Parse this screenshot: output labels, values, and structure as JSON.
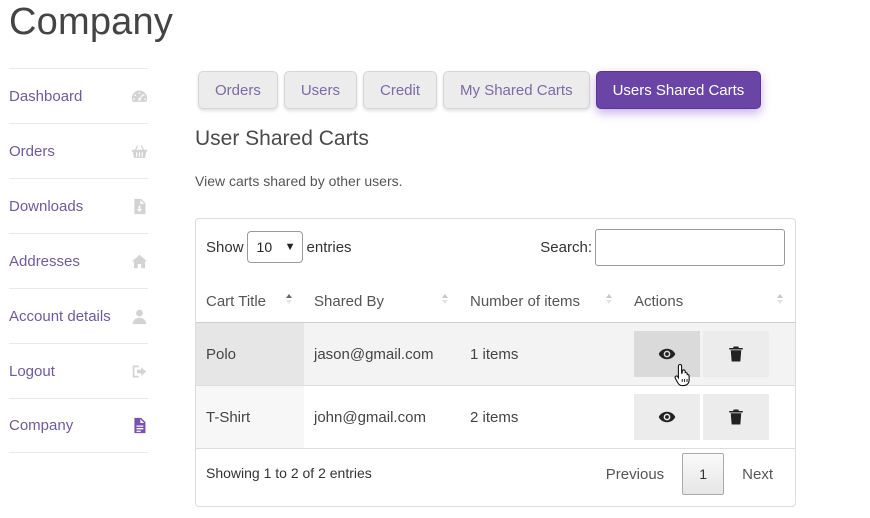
{
  "page": {
    "title": "Company"
  },
  "sidebar": {
    "items": [
      {
        "label": "Dashboard",
        "icon": "dashboard-icon"
      },
      {
        "label": "Orders",
        "icon": "basket-icon"
      },
      {
        "label": "Downloads",
        "icon": "file-download-icon"
      },
      {
        "label": "Addresses",
        "icon": "home-icon"
      },
      {
        "label": "Account details",
        "icon": "user-icon"
      },
      {
        "label": "Logout",
        "icon": "sign-out-icon"
      },
      {
        "label": "Company",
        "icon": "document-icon",
        "active": true
      }
    ]
  },
  "tabs": [
    {
      "label": "Orders"
    },
    {
      "label": "Users"
    },
    {
      "label": "Credit"
    },
    {
      "label": "My Shared Carts"
    },
    {
      "label": "Users Shared Carts",
      "active": true
    }
  ],
  "section": {
    "title": "User Shared Carts",
    "description": "View carts shared by other users."
  },
  "table": {
    "length_prefix": "Show",
    "length_value": "10",
    "length_suffix": "entries",
    "search_label": "Search:",
    "search_value": "",
    "columns": [
      "Cart Title",
      "Shared By",
      "Number of items",
      "Actions"
    ],
    "rows": [
      {
        "title": "Polo",
        "shared_by": "jason@gmail.com",
        "items": "1 items"
      },
      {
        "title": "T-Shirt",
        "shared_by": "john@gmail.com",
        "items": "2 items"
      }
    ],
    "info": "Showing 1 to 2 of 2 entries",
    "pagination": {
      "previous": "Previous",
      "current": "1",
      "next": "Next"
    }
  },
  "colors": {
    "accent": "#6a45a6",
    "link": "#6f5a9c"
  }
}
